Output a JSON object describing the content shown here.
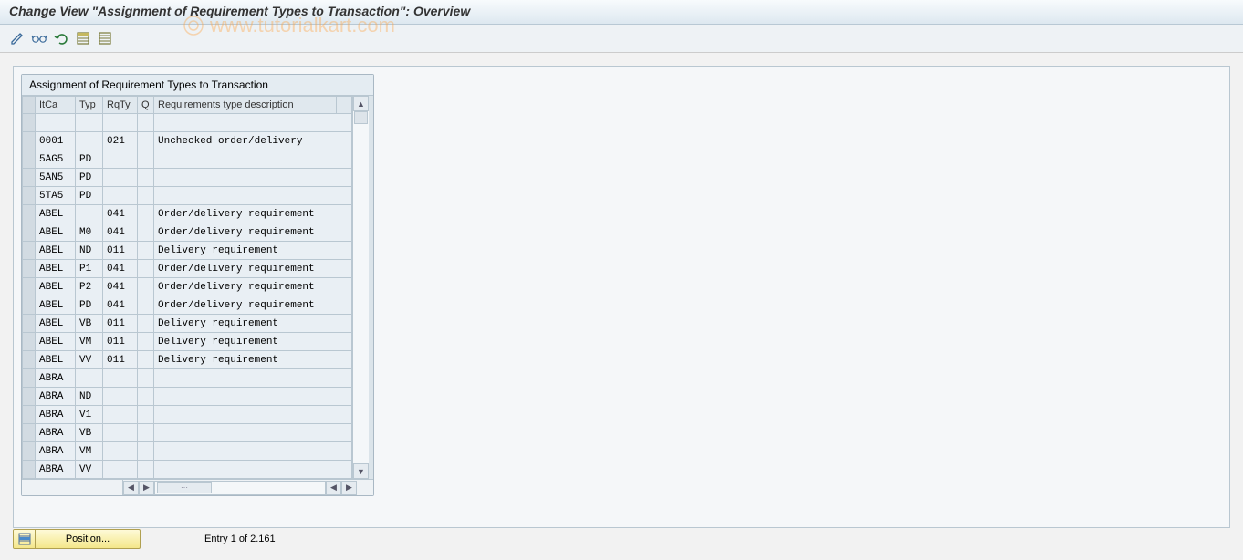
{
  "title": "Change View \"Assignment of Requirement Types to Transaction\": Overview",
  "watermark": "www.tutorialkart.com",
  "toolbar": {
    "icons": [
      "display-change-toggle",
      "other-entry",
      "undo",
      "select-all",
      "deselect-all"
    ]
  },
  "panel": {
    "title": "Assignment of Requirement Types to Transaction",
    "columns": {
      "itca": "ItCa",
      "typ": "Typ",
      "rqty": "RqTy",
      "q": "Q",
      "desc": "Requirements type description"
    },
    "rows": [
      {
        "itca": "",
        "typ": "",
        "rqty": "",
        "q": "",
        "desc": ""
      },
      {
        "itca": "0001",
        "typ": "",
        "rqty": "021",
        "q": "",
        "desc": "Unchecked order/delivery"
      },
      {
        "itca": "5AG5",
        "typ": "PD",
        "rqty": "",
        "q": "",
        "desc": ""
      },
      {
        "itca": "5AN5",
        "typ": "PD",
        "rqty": "",
        "q": "",
        "desc": ""
      },
      {
        "itca": "5TA5",
        "typ": "PD",
        "rqty": "",
        "q": "",
        "desc": ""
      },
      {
        "itca": "ABEL",
        "typ": "",
        "rqty": "041",
        "q": "",
        "desc": "Order/delivery requirement"
      },
      {
        "itca": "ABEL",
        "typ": "M0",
        "rqty": "041",
        "q": "",
        "desc": "Order/delivery requirement"
      },
      {
        "itca": "ABEL",
        "typ": "ND",
        "rqty": "011",
        "q": "",
        "desc": "Delivery requirement"
      },
      {
        "itca": "ABEL",
        "typ": "P1",
        "rqty": "041",
        "q": "",
        "desc": "Order/delivery requirement"
      },
      {
        "itca": "ABEL",
        "typ": "P2",
        "rqty": "041",
        "q": "",
        "desc": "Order/delivery requirement"
      },
      {
        "itca": "ABEL",
        "typ": "PD",
        "rqty": "041",
        "q": "",
        "desc": "Order/delivery requirement"
      },
      {
        "itca": "ABEL",
        "typ": "VB",
        "rqty": "011",
        "q": "",
        "desc": "Delivery requirement"
      },
      {
        "itca": "ABEL",
        "typ": "VM",
        "rqty": "011",
        "q": "",
        "desc": "Delivery requirement"
      },
      {
        "itca": "ABEL",
        "typ": "VV",
        "rqty": "011",
        "q": "",
        "desc": "Delivery requirement"
      },
      {
        "itca": "ABRA",
        "typ": "",
        "rqty": "",
        "q": "",
        "desc": ""
      },
      {
        "itca": "ABRA",
        "typ": "ND",
        "rqty": "",
        "q": "",
        "desc": ""
      },
      {
        "itca": "ABRA",
        "typ": "V1",
        "rqty": "",
        "q": "",
        "desc": ""
      },
      {
        "itca": "ABRA",
        "typ": "VB",
        "rqty": "",
        "q": "",
        "desc": ""
      },
      {
        "itca": "ABRA",
        "typ": "VM",
        "rqty": "",
        "q": "",
        "desc": ""
      },
      {
        "itca": "ABRA",
        "typ": "VV",
        "rqty": "",
        "q": "",
        "desc": ""
      }
    ]
  },
  "footer": {
    "position_btn": "Position...",
    "status": "Entry 1 of 2.161"
  }
}
